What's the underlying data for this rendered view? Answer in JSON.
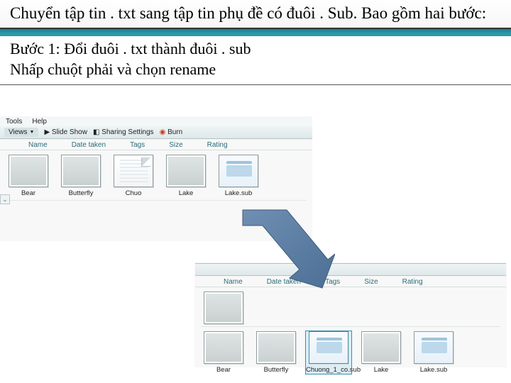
{
  "title": "Chuyển tập tin . txt sang tập tin phụ đề có đuôi . Sub. Bao gồm hai bước:",
  "step": {
    "line1": "Bước 1: Đổi đuôi . txt thành đuôi . sub",
    "line2": "Nhấp chuột phải và chọn rename"
  },
  "menubar": {
    "tools": "Tools",
    "help": "Help"
  },
  "toolbar": {
    "views": "Views",
    "slideshow": "Slide Show",
    "sharing": "Sharing Settings",
    "burn": "Burn"
  },
  "columns": {
    "name": "Name",
    "date": "Date taken",
    "tags": "Tags",
    "size": "Size",
    "rating": "Rating"
  },
  "shot1_files": [
    {
      "label": "Bear",
      "kind": "vid",
      "frame": "bear"
    },
    {
      "label": "Butterfly",
      "kind": "vid",
      "frame": "butterfly"
    },
    {
      "label": "Chuo",
      "kind": "txt"
    },
    {
      "label": "Lake",
      "kind": "vid",
      "frame": "lake"
    },
    {
      "label": "Lake.sub",
      "kind": "note"
    }
  ],
  "shot2_files": [
    {
      "label": "Bear",
      "kind": "vid",
      "frame": "bear"
    },
    {
      "label": "Butterfly",
      "kind": "vid",
      "frame": "butterfly"
    },
    {
      "label": "Chuong_1_co.sub",
      "kind": "note",
      "selected": true
    },
    {
      "label": "Lake",
      "kind": "vid",
      "frame": "lake"
    },
    {
      "label": "Lake.sub",
      "kind": "note"
    }
  ],
  "shot2_extra_row": [
    {
      "label": "",
      "kind": "vid",
      "frame": "bird"
    }
  ]
}
